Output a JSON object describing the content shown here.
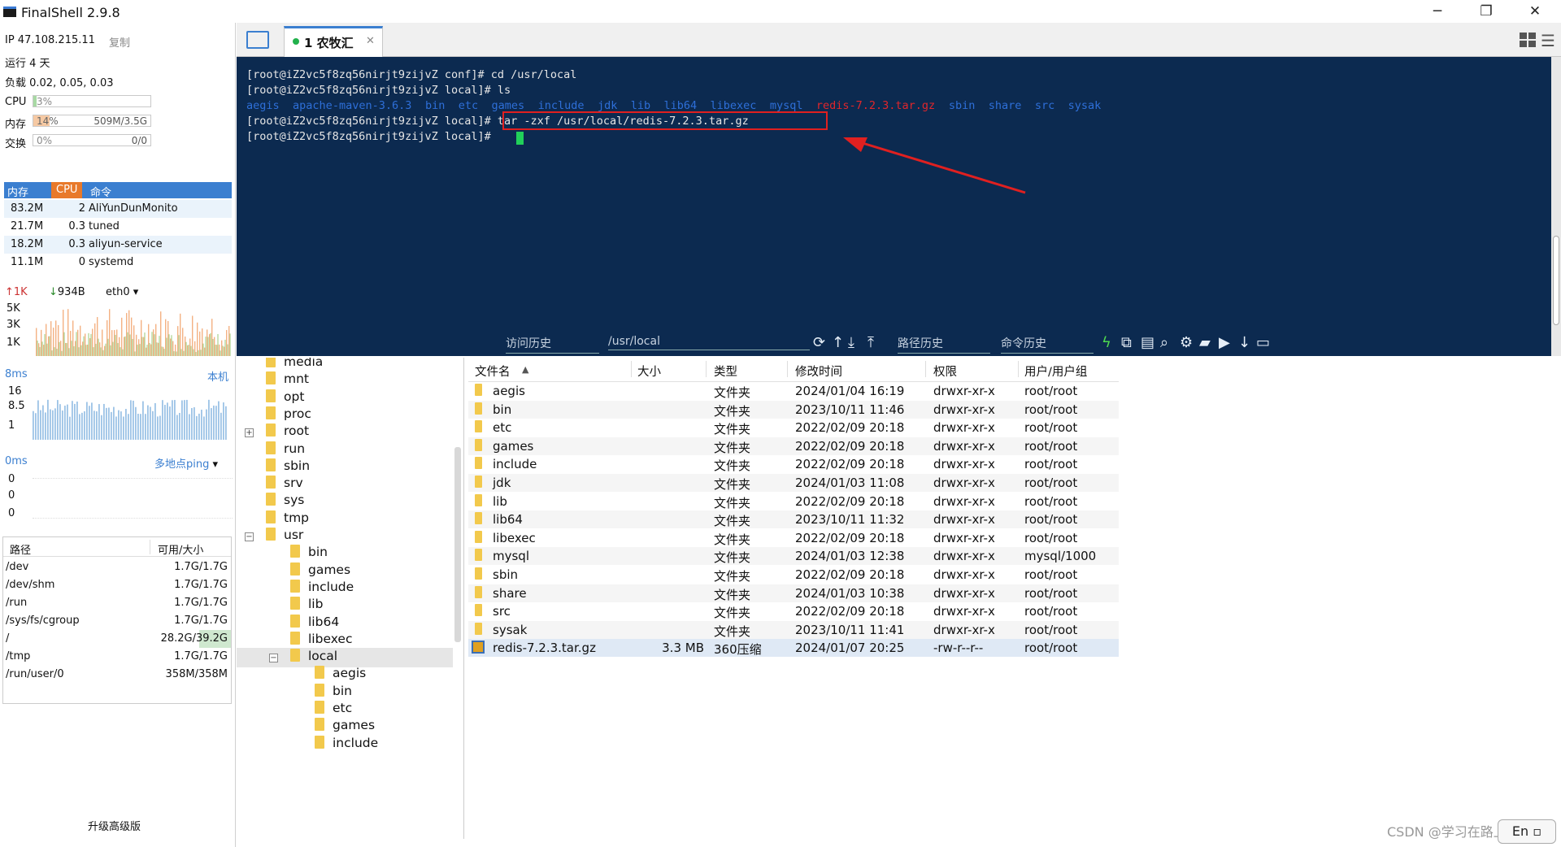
{
  "window": {
    "title": "FinalShell 2.9.8",
    "minimize": "─",
    "restore": "❐",
    "close": "✕"
  },
  "sysinfo": {
    "ip": "IP 47.108.215.11",
    "copy": "复制",
    "uptime": "运行 4 天",
    "load": "负载 0.02, 0.05, 0.03",
    "cpu_label": "CPU",
    "cpu_value": "3%",
    "cpu_fraction": 0.03,
    "mem_label": "内存",
    "mem_value": "14%",
    "mem_fraction": 0.14,
    "mem_total": "509M/3.5G",
    "swap_label": "交换",
    "swap_value": "0%",
    "swap_total": "0/0"
  },
  "processes": {
    "headers": [
      "内存",
      "CPU",
      "命令"
    ],
    "rows": [
      {
        "mem": "83.2M",
        "cpu": "2",
        "cmd": "AliYunDunMonito"
      },
      {
        "mem": "21.7M",
        "cpu": "0.3",
        "cmd": "tuned"
      },
      {
        "mem": "18.2M",
        "cpu": "0.3",
        "cmd": "aliyun-service"
      },
      {
        "mem": "11.1M",
        "cpu": "0",
        "cmd": "systemd"
      }
    ]
  },
  "network": {
    "up": "1K",
    "down": "934B",
    "iface": "eth0",
    "ticks": [
      "5K",
      "3K",
      "1K"
    ]
  },
  "latency": {
    "top_label": "8ms",
    "source": "本机",
    "ticks": [
      "16",
      "8.5",
      "1"
    ],
    "bottom_label": "0ms",
    "ping": "多地点ping",
    "ping_ticks": [
      "0",
      "0",
      "0"
    ]
  },
  "disks": {
    "headers": [
      "路径",
      "可用/大小"
    ],
    "rows": [
      {
        "path": "/dev",
        "size": "1.7G/1.7G"
      },
      {
        "path": "/dev/shm",
        "size": "1.7G/1.7G"
      },
      {
        "path": "/run",
        "size": "1.7G/1.7G"
      },
      {
        "path": "/sys/fs/cgroup",
        "size": "1.7G/1.7G"
      },
      {
        "path": "/",
        "size": "28.2G/39.2G"
      },
      {
        "path": "/tmp",
        "size": "1.7G/1.7G"
      },
      {
        "path": "/run/user/0",
        "size": "358M/358M"
      }
    ]
  },
  "upgrade": "升级高级版",
  "tab": {
    "label": "1 农牧汇",
    "close": "✕"
  },
  "terminal": {
    "lines": [
      "[root@iZ2vc5f8zq56nirjt9zijvZ conf]# cd /usr/local",
      "[root@iZ2vc5f8zq56nirjt9zijvZ local]# ls",
      "",
      "[root@iZ2vc5f8zq56nirjt9zijvZ local]# tar -zxf /usr/local/redis-7.2.3.tar.gz",
      "[root@iZ2vc5f8zq56nirjt9zijvZ local]# "
    ],
    "ls_output": [
      {
        "name": "aegis",
        "color": "#2e6fd8"
      },
      {
        "name": "apache-maven-3.6.3",
        "color": "#2e6fd8"
      },
      {
        "name": "bin",
        "color": "#2e6fd8"
      },
      {
        "name": "etc",
        "color": "#2e6fd8"
      },
      {
        "name": "games",
        "color": "#2e6fd8"
      },
      {
        "name": "include",
        "color": "#2e6fd8"
      },
      {
        "name": "jdk",
        "color": "#2e6fd8"
      },
      {
        "name": "lib",
        "color": "#2e6fd8"
      },
      {
        "name": "lib64",
        "color": "#2e6fd8"
      },
      {
        "name": "libexec",
        "color": "#2e6fd8"
      },
      {
        "name": "mysql",
        "color": "#2e6fd8"
      },
      {
        "name": "redis-7.2.3.tar.gz",
        "color": "#e0262b"
      },
      {
        "name": "sbin",
        "color": "#2e6fd8"
      },
      {
        "name": "share",
        "color": "#2e6fd8"
      },
      {
        "name": "src",
        "color": "#2e6fd8"
      },
      {
        "name": "sysak",
        "color": "#2e6fd8"
      }
    ],
    "highlight_color": "#e02020",
    "cursor_color": "#21d05a"
  },
  "term_toolbar": {
    "history": "访问历史",
    "path": "/usr/local",
    "path_history": "路径历史",
    "cmd_history": "命令历史"
  },
  "tree": {
    "items": [
      {
        "name": "media",
        "level": 0
      },
      {
        "name": "mnt",
        "level": 0
      },
      {
        "name": "opt",
        "level": 0
      },
      {
        "name": "proc",
        "level": 0
      },
      {
        "name": "root",
        "level": 0
      },
      {
        "name": "run",
        "level": 0
      },
      {
        "name": "sbin",
        "level": 0
      },
      {
        "name": "srv",
        "level": 0
      },
      {
        "name": "sys",
        "level": 0
      },
      {
        "name": "tmp",
        "level": 0
      },
      {
        "name": "usr",
        "level": 0
      },
      {
        "name": "bin",
        "level": 1
      },
      {
        "name": "games",
        "level": 1
      },
      {
        "name": "include",
        "level": 1
      },
      {
        "name": "lib",
        "level": 1
      },
      {
        "name": "lib64",
        "level": 1
      },
      {
        "name": "libexec",
        "level": 1
      },
      {
        "name": "local",
        "level": 1
      },
      {
        "name": "aegis",
        "level": 2
      },
      {
        "name": "bin",
        "level": 2
      },
      {
        "name": "etc",
        "level": 2
      },
      {
        "name": "games",
        "level": 2
      },
      {
        "name": "include",
        "level": 2
      }
    ]
  },
  "files": {
    "headers": [
      "文件名",
      "大小",
      "类型",
      "修改时间",
      "权限",
      "用户/用户组"
    ],
    "rows": [
      {
        "name": "aegis",
        "size": "",
        "type": "文件夹",
        "mtime": "2024/01/04 16:19",
        "perm": "drwxr-xr-x",
        "owner": "root/root"
      },
      {
        "name": "bin",
        "size": "",
        "type": "文件夹",
        "mtime": "2023/10/11 11:46",
        "perm": "drwxr-xr-x",
        "owner": "root/root"
      },
      {
        "name": "etc",
        "size": "",
        "type": "文件夹",
        "mtime": "2022/02/09 20:18",
        "perm": "drwxr-xr-x",
        "owner": "root/root"
      },
      {
        "name": "games",
        "size": "",
        "type": "文件夹",
        "mtime": "2022/02/09 20:18",
        "perm": "drwxr-xr-x",
        "owner": "root/root"
      },
      {
        "name": "include",
        "size": "",
        "type": "文件夹",
        "mtime": "2022/02/09 20:18",
        "perm": "drwxr-xr-x",
        "owner": "root/root"
      },
      {
        "name": "jdk",
        "size": "",
        "type": "文件夹",
        "mtime": "2024/01/03 11:08",
        "perm": "drwxr-xr-x",
        "owner": "root/root"
      },
      {
        "name": "lib",
        "size": "",
        "type": "文件夹",
        "mtime": "2022/02/09 20:18",
        "perm": "drwxr-xr-x",
        "owner": "root/root"
      },
      {
        "name": "lib64",
        "size": "",
        "type": "文件夹",
        "mtime": "2023/10/11 11:32",
        "perm": "drwxr-xr-x",
        "owner": "root/root"
      },
      {
        "name": "libexec",
        "size": "",
        "type": "文件夹",
        "mtime": "2022/02/09 20:18",
        "perm": "drwxr-xr-x",
        "owner": "root/root"
      },
      {
        "name": "mysql",
        "size": "",
        "type": "文件夹",
        "mtime": "2024/01/03 12:38",
        "perm": "drwxr-xr-x",
        "owner": "mysql/1000"
      },
      {
        "name": "sbin",
        "size": "",
        "type": "文件夹",
        "mtime": "2022/02/09 20:18",
        "perm": "drwxr-xr-x",
        "owner": "root/root"
      },
      {
        "name": "share",
        "size": "",
        "type": "文件夹",
        "mtime": "2024/01/03 10:38",
        "perm": "drwxr-xr-x",
        "owner": "root/root"
      },
      {
        "name": "src",
        "size": "",
        "type": "文件夹",
        "mtime": "2022/02/09 20:18",
        "perm": "drwxr-xr-x",
        "owner": "root/root"
      },
      {
        "name": "sysak",
        "size": "",
        "type": "文件夹",
        "mtime": "2023/10/11 11:41",
        "perm": "drwxr-xr-x",
        "owner": "root/root"
      },
      {
        "name": "redis-7.2.3.tar.gz",
        "size": "3.3 MB",
        "type": "360压缩",
        "mtime": "2024/01/07 20:25",
        "perm": "-rw-r--r--",
        "owner": "root/root"
      }
    ]
  },
  "watermark": "CSDN @学习在路上ing",
  "ime": "En ▫"
}
